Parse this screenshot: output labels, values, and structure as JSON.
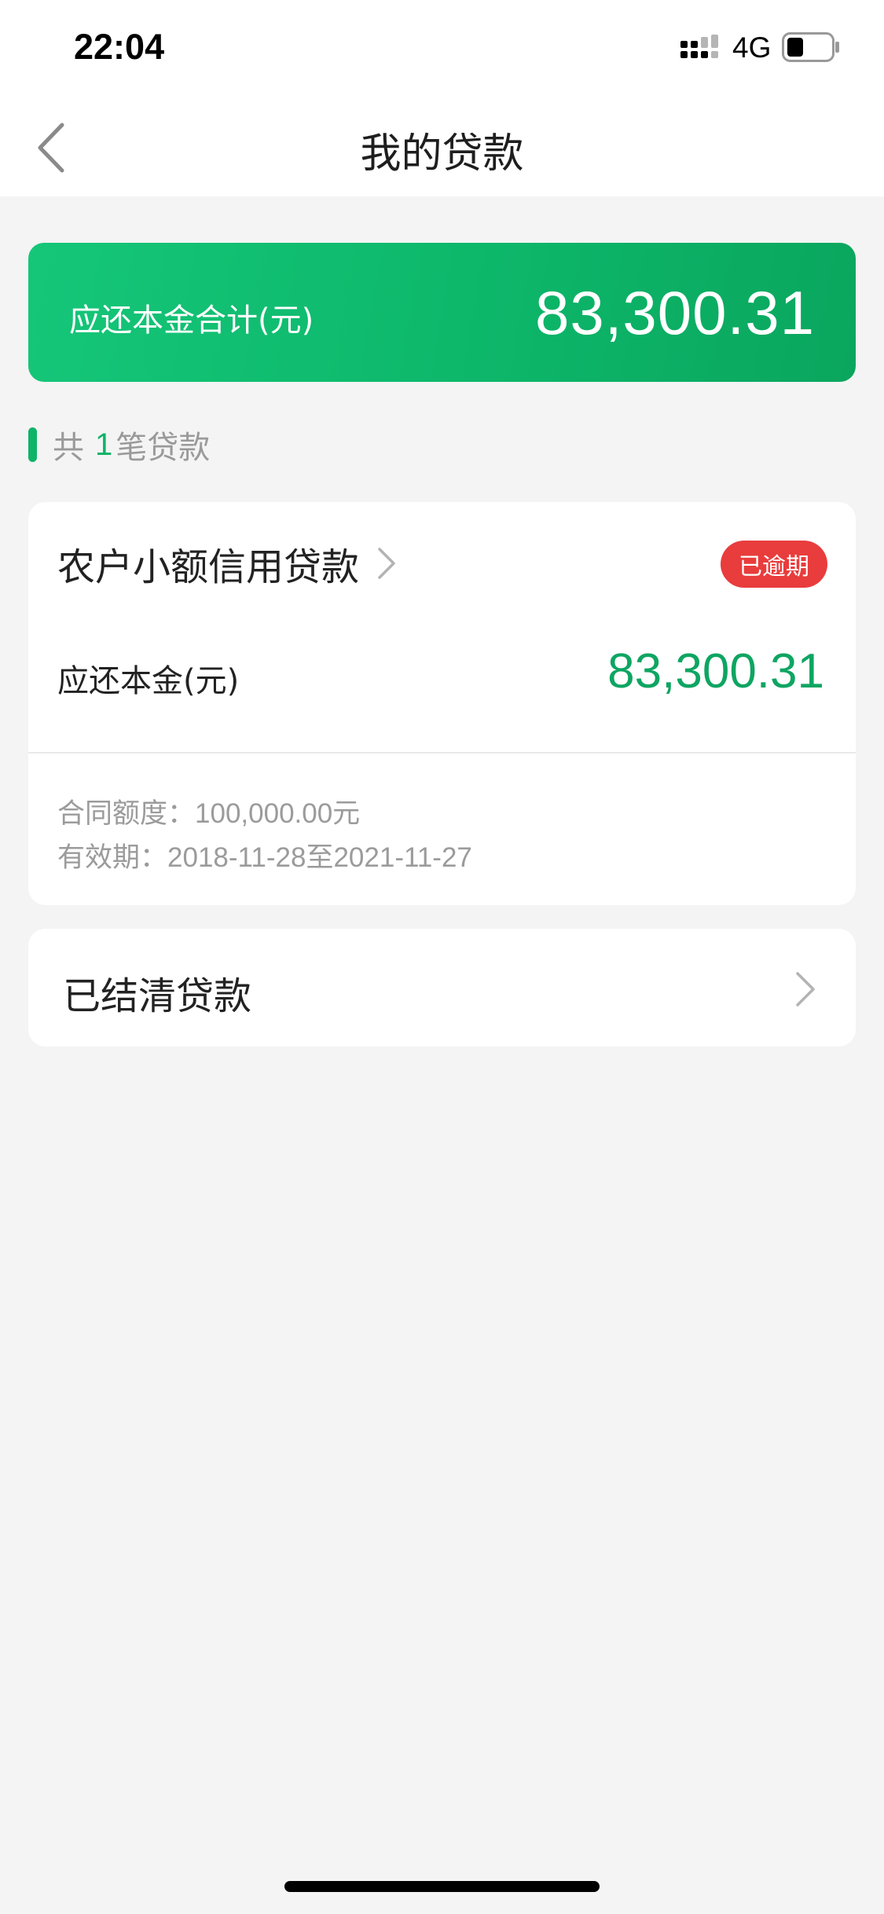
{
  "status_bar": {
    "time": "22:04",
    "network": "4G",
    "icons": [
      "signal-icon",
      "battery-icon"
    ]
  },
  "nav": {
    "title": "我的贷款",
    "back_icon": "chevron-left-icon"
  },
  "summary": {
    "label": "应还本金合计(元)",
    "amount": "83,300.31"
  },
  "loan_count": {
    "prefix": "共",
    "number": "1",
    "suffix": "笔贷款"
  },
  "loans": [
    {
      "name": "农户小额信用贷款",
      "status": "已逾期",
      "principal_label": "应还本金(元)",
      "principal_amount": "83,300.31",
      "contract_label": "合同额度：",
      "contract_value": "100,000.00元",
      "validity_label": "有效期：",
      "validity_value": "2018-11-28至2021-11-27"
    }
  ],
  "settled": {
    "label": "已结清贷款"
  },
  "colors": {
    "brand_green": "#0fb468",
    "amount_green": "#0ea562",
    "overdue_red": "#e93c3c",
    "background": "#f4f4f4"
  }
}
